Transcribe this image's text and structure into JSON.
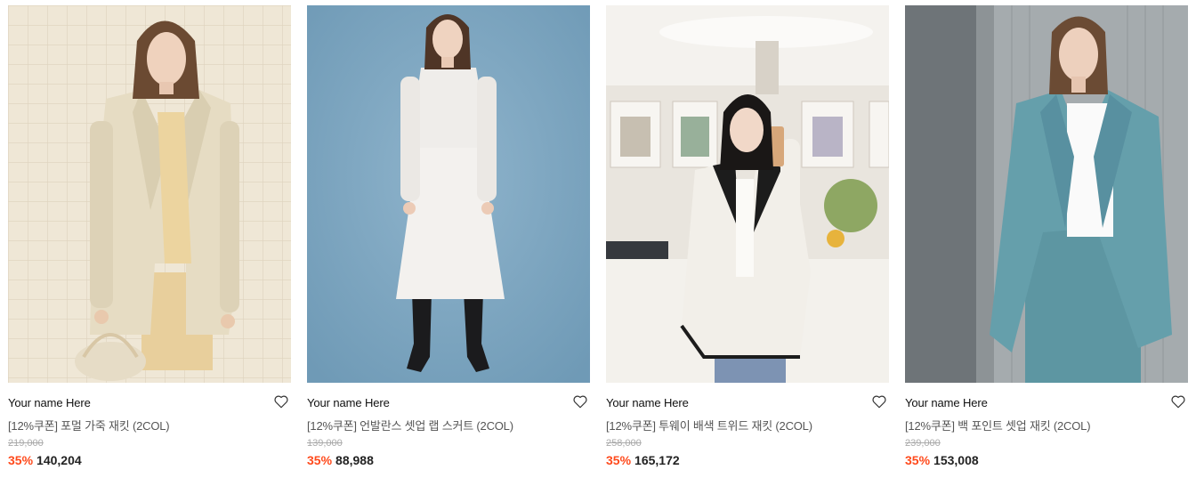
{
  "products": [
    {
      "brand": "Your name Here",
      "name": "[12%쿠폰] 포멀 가죽 재킷 (2COL)",
      "original_price": "219,000",
      "discount": "35%",
      "price": "140,204"
    },
    {
      "brand": "Your name Here",
      "name": "[12%쿠폰] 언발란스 셋업 랩 스커트 (2COL)",
      "original_price": "139,000",
      "discount": "35%",
      "price": "88,988"
    },
    {
      "brand": "Your name Here",
      "name": "[12%쿠폰] 투웨이 배색 트위드 재킷 (2COL)",
      "original_price": "258,000",
      "discount": "35%",
      "price": "165,172"
    },
    {
      "brand": "Your name Here",
      "name": "[12%쿠폰] 백 포인트 셋업 재킷 (2COL)",
      "original_price": "239,000",
      "discount": "35%",
      "price": "153,008"
    }
  ],
  "icons": {
    "wishlist": "heart-outline-icon"
  },
  "colors": {
    "discount": "#ff4a1c",
    "original_price": "#aaaaaa",
    "text": "#222222"
  }
}
